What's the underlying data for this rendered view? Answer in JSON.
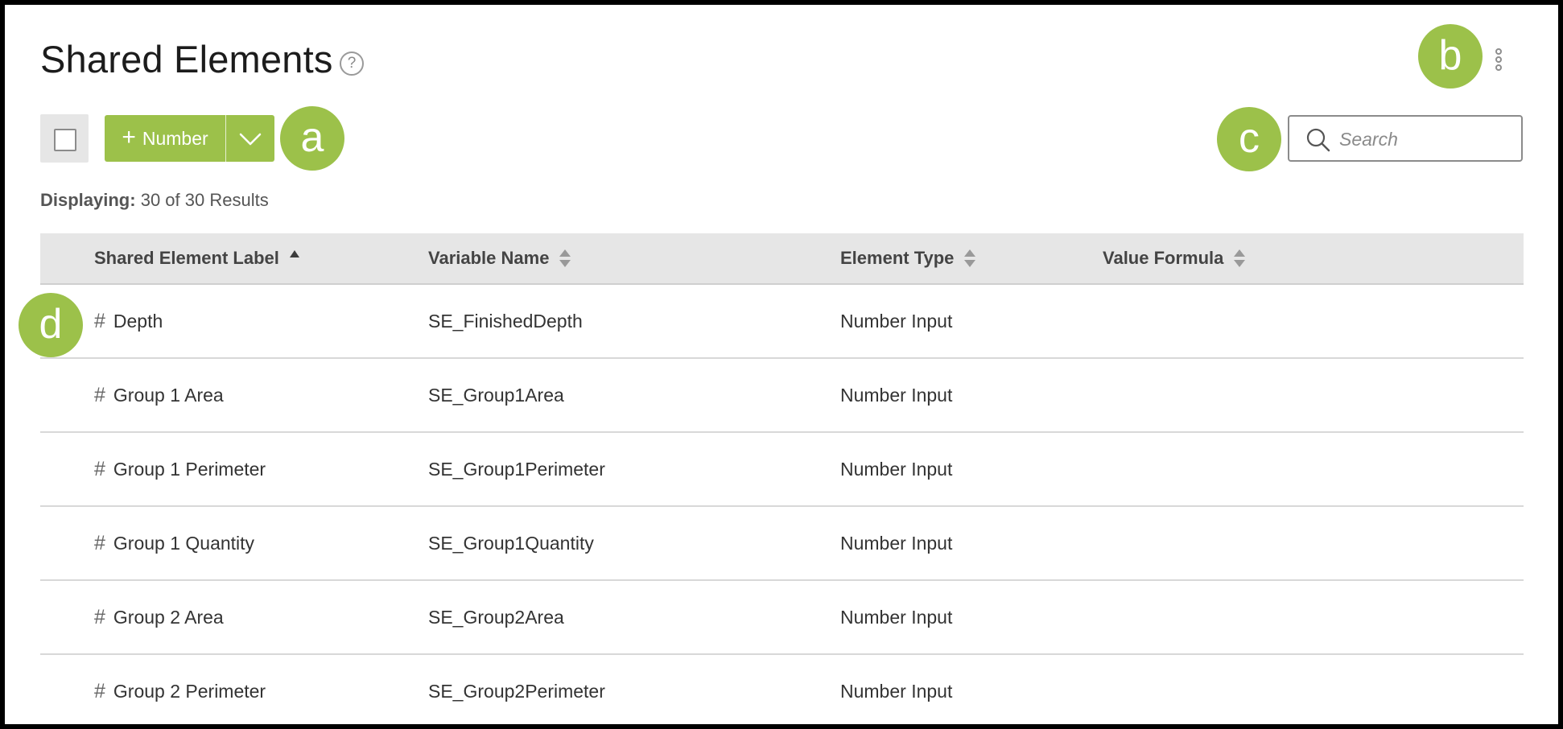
{
  "header": {
    "title": "Shared Elements",
    "help_glyph": "?"
  },
  "badges": {
    "a": "a",
    "b": "b",
    "c": "c",
    "d": "d"
  },
  "toolbar": {
    "add_button_label": "Number",
    "add_button_icon": "plus-icon",
    "dropdown_icon": "chevron-down-icon",
    "search_placeholder": "Search"
  },
  "results": {
    "label": "Displaying:",
    "text": "30 of 30 Results"
  },
  "table": {
    "columns": [
      {
        "label": "Shared Element Label",
        "sort": "ascending"
      },
      {
        "label": "Variable Name",
        "sort": "none"
      },
      {
        "label": "Element Type",
        "sort": "none"
      },
      {
        "label": "Value Formula",
        "sort": "none"
      }
    ],
    "rows": [
      {
        "icon": "#",
        "label": "Depth",
        "variable": "SE_FinishedDepth",
        "type": "Number Input",
        "formula": ""
      },
      {
        "icon": "#",
        "label": "Group 1 Area",
        "variable": "SE_Group1Area",
        "type": "Number Input",
        "formula": ""
      },
      {
        "icon": "#",
        "label": "Group 1 Perimeter",
        "variable": "SE_Group1Perimeter",
        "type": "Number Input",
        "formula": ""
      },
      {
        "icon": "#",
        "label": "Group 1 Quantity",
        "variable": "SE_Group1Quantity",
        "type": "Number Input",
        "formula": ""
      },
      {
        "icon": "#",
        "label": "Group 2 Area",
        "variable": "SE_Group2Area",
        "type": "Number Input",
        "formula": ""
      },
      {
        "icon": "#",
        "label": "Group 2 Perimeter",
        "variable": "SE_Group2Perimeter",
        "type": "Number Input",
        "formula": ""
      }
    ]
  },
  "colors": {
    "accent": "#9cc14a",
    "header_bg": "#e6e6e6"
  }
}
